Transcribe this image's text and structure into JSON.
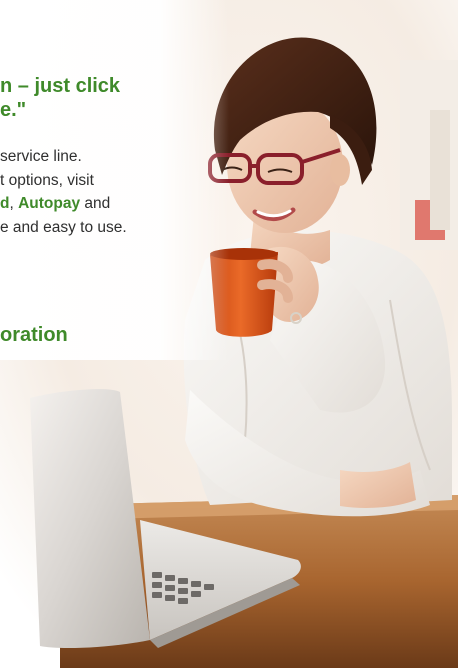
{
  "headline": {
    "line1": "n – just click",
    "line2": "e.\""
  },
  "body": {
    "line1": "service line.",
    "line2": "t options, visit",
    "line3_link1": "d",
    "line3_sep": ", ",
    "line3_link2": "Autopay",
    "line3_after": " and",
    "line4": "e and easy to use."
  },
  "subheading": "oration",
  "colors": {
    "brand_green": "#3f8a2a",
    "body_text": "#2f2f2f"
  }
}
